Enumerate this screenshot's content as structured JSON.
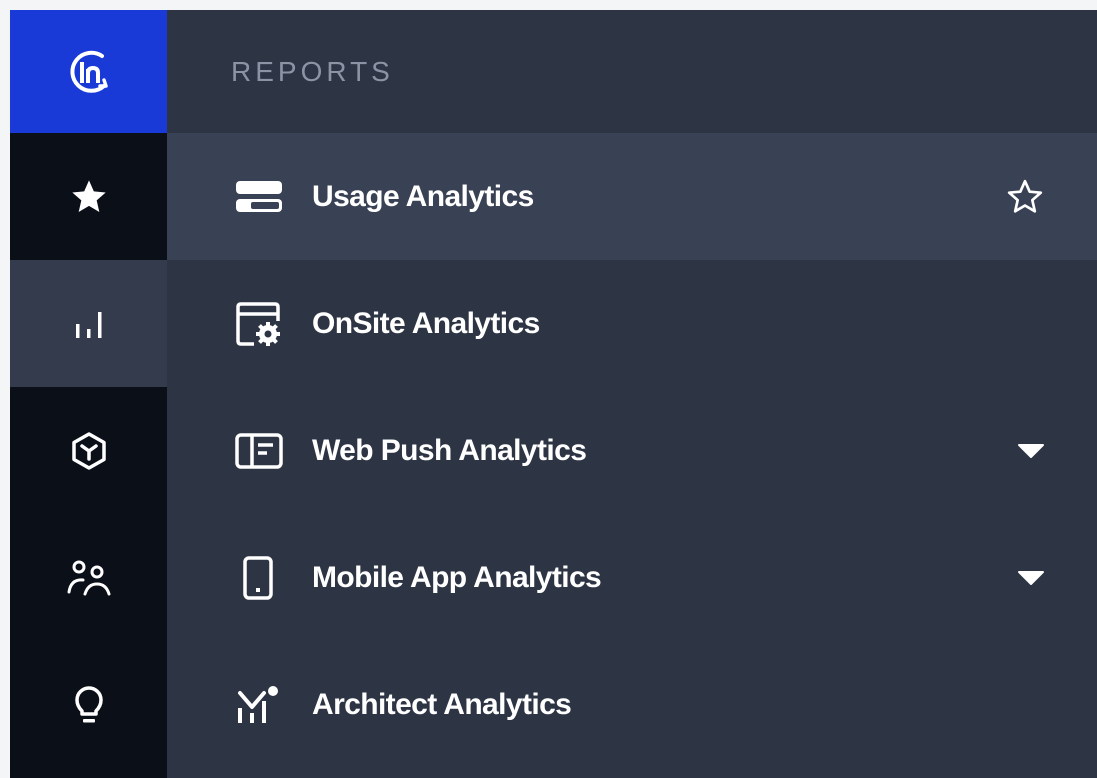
{
  "rail": {
    "items": [
      {
        "name": "logo",
        "icon": "in-logo-icon"
      },
      {
        "name": "favorites",
        "icon": "star-icon"
      },
      {
        "name": "reports",
        "icon": "bar-chart-icon",
        "active": true
      },
      {
        "name": "product",
        "icon": "cube-icon"
      },
      {
        "name": "audience",
        "icon": "users-icon"
      },
      {
        "name": "insights",
        "icon": "lightbulb-icon"
      }
    ]
  },
  "panel": {
    "title": "REPORTS",
    "items": [
      {
        "label": "Usage Analytics",
        "icon": "stacked-bars-icon",
        "trail": "star-outline-icon"
      },
      {
        "label": "OnSite Analytics",
        "icon": "window-gear-icon"
      },
      {
        "label": "Web Push Analytics",
        "icon": "panel-layout-icon",
        "trail": "caret-down-icon"
      },
      {
        "label": "Mobile App Analytics",
        "icon": "smartphone-icon",
        "trail": "caret-down-icon"
      },
      {
        "label": "Architect Analytics",
        "icon": "architect-icon"
      }
    ]
  },
  "colors": {
    "rail_bg": "#0b0f18",
    "logo_bg": "#1a3ad8",
    "panel_bg": "#2d3444",
    "hover_bg": "#394154",
    "active_rail_bg": "#343b4d",
    "title_color": "#8b93a5"
  }
}
